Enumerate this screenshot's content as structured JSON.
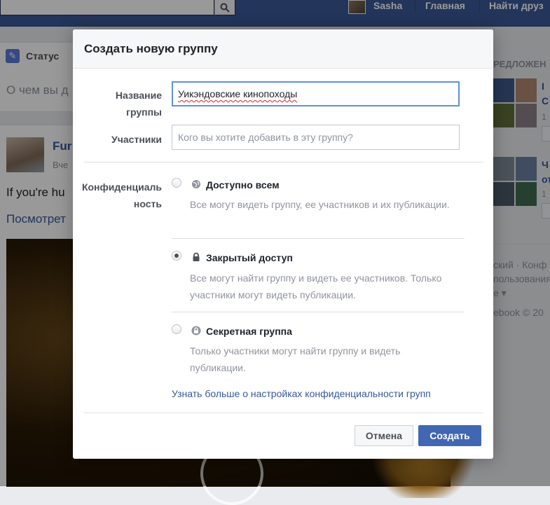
{
  "topbar": {
    "user_name": "Sasha",
    "home_label": "Главная",
    "find_friends_label": "Найти друз"
  },
  "composer": {
    "tab_label": "Статус",
    "placeholder": "О чем вы д"
  },
  "post": {
    "author": "Fur",
    "date": "Вче",
    "text": "If you're hu",
    "link": "Посмотрет"
  },
  "right_column": {
    "heading": "РЕДЛОЖЕН",
    "suggestions": [
      {
        "title": "I",
        "title2": "С",
        "count": "1"
      },
      {
        "title": "Ч",
        "title2": "от",
        "count": "1"
      }
    ],
    "footer": [
      "ский · Конф",
      "пользования",
      "е ▾",
      "ebook © 20"
    ]
  },
  "dialog": {
    "title": "Создать новую группу",
    "name_label": "Название группы",
    "name_value": "Уикэндовские кинопоходы",
    "members_label": "Участники",
    "members_placeholder": "Кого вы хотите добавить в эту группу?",
    "privacy_label": "Конфиденциальность",
    "privacy_options": [
      {
        "title": "Доступно всем",
        "description": "Все могут видеть группу, ее участников и их публикации.",
        "icon": "globe-icon",
        "checked": false
      },
      {
        "title": "Закрытый доступ",
        "description": "Все могут найти группу и видеть ее участников. Только участники могут видеть публикации.",
        "icon": "lock-icon",
        "checked": true
      },
      {
        "title": "Секретная группа",
        "description": "Только участники могут найти группу и видеть публикации.",
        "icon": "secret-lock-icon",
        "checked": false
      }
    ],
    "learn_more": "Узнать больше о настройках конфиденциальности групп",
    "cancel_label": "Отмена",
    "create_label": "Создать"
  },
  "colors": {
    "topbar": "#3b5998",
    "primary_button": "#4267b2",
    "link": "#365899"
  }
}
